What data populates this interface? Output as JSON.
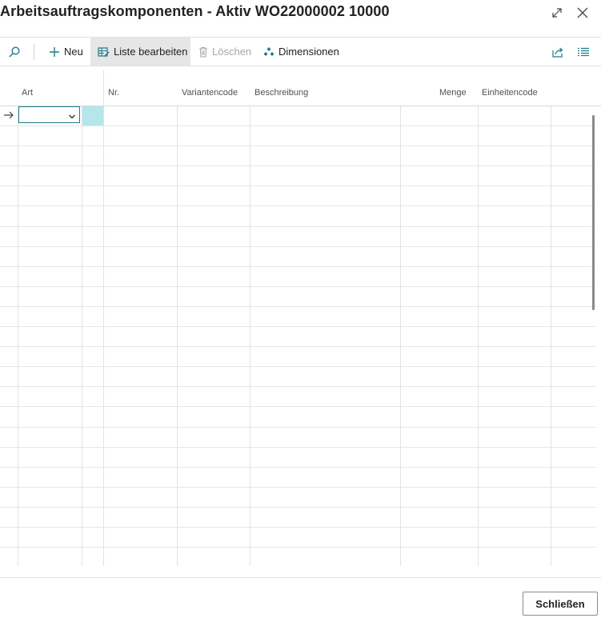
{
  "window": {
    "title": "Arbeitsauftragskomponenten - Aktiv WO22000002 10000"
  },
  "toolbar": {
    "new_label": "Neu",
    "edit_list_label": "Liste bearbeiten",
    "delete_label": "Löschen",
    "dimensions_label": "Dimensionen"
  },
  "table": {
    "columns": [
      "Art",
      "Nr.",
      "Variantencode",
      "Beschreibung",
      "Menge",
      "Einheitencode"
    ],
    "rows": [
      {
        "art": "",
        "nr": "",
        "variantencode": "",
        "beschreibung": "",
        "menge": "",
        "einheitencode": ""
      }
    ]
  },
  "footer": {
    "close_label": "Schließen"
  },
  "colors": {
    "accent": "#1f7c86",
    "selected_cell": "#b6e6ea",
    "active_action": "#e6e6e6"
  }
}
